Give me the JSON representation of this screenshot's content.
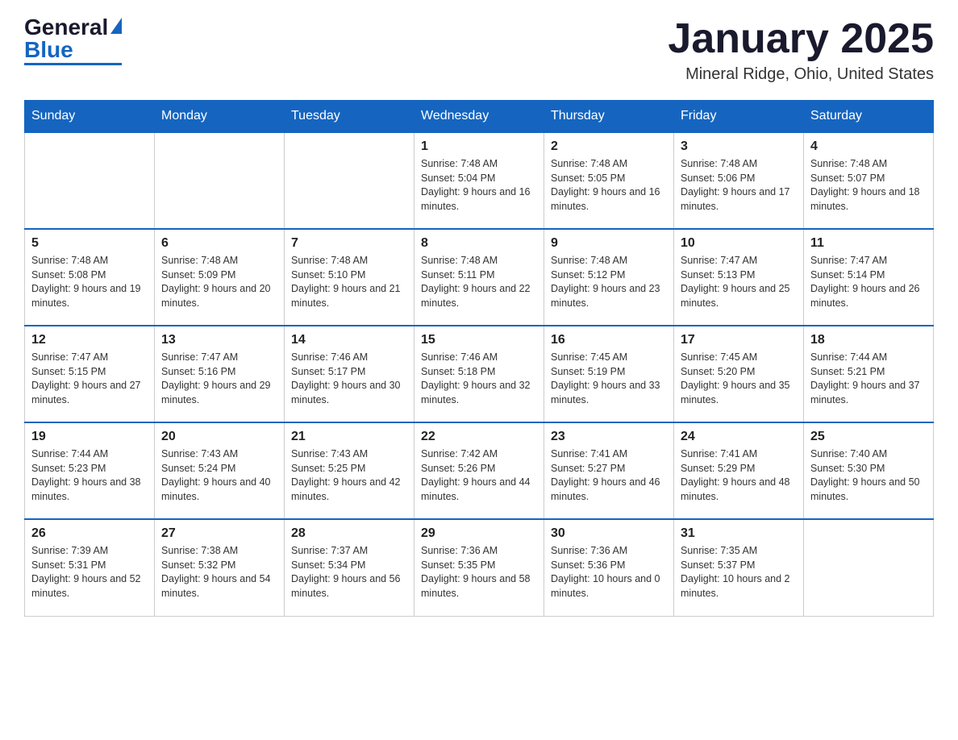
{
  "logo": {
    "general": "General",
    "blue": "Blue"
  },
  "header": {
    "title": "January 2025",
    "subtitle": "Mineral Ridge, Ohio, United States"
  },
  "weekdays": [
    "Sunday",
    "Monday",
    "Tuesday",
    "Wednesday",
    "Thursday",
    "Friday",
    "Saturday"
  ],
  "weeks": [
    [
      {
        "day": "",
        "info": ""
      },
      {
        "day": "",
        "info": ""
      },
      {
        "day": "",
        "info": ""
      },
      {
        "day": "1",
        "info": "Sunrise: 7:48 AM\nSunset: 5:04 PM\nDaylight: 9 hours and 16 minutes."
      },
      {
        "day": "2",
        "info": "Sunrise: 7:48 AM\nSunset: 5:05 PM\nDaylight: 9 hours and 16 minutes."
      },
      {
        "day": "3",
        "info": "Sunrise: 7:48 AM\nSunset: 5:06 PM\nDaylight: 9 hours and 17 minutes."
      },
      {
        "day": "4",
        "info": "Sunrise: 7:48 AM\nSunset: 5:07 PM\nDaylight: 9 hours and 18 minutes."
      }
    ],
    [
      {
        "day": "5",
        "info": "Sunrise: 7:48 AM\nSunset: 5:08 PM\nDaylight: 9 hours and 19 minutes."
      },
      {
        "day": "6",
        "info": "Sunrise: 7:48 AM\nSunset: 5:09 PM\nDaylight: 9 hours and 20 minutes."
      },
      {
        "day": "7",
        "info": "Sunrise: 7:48 AM\nSunset: 5:10 PM\nDaylight: 9 hours and 21 minutes."
      },
      {
        "day": "8",
        "info": "Sunrise: 7:48 AM\nSunset: 5:11 PM\nDaylight: 9 hours and 22 minutes."
      },
      {
        "day": "9",
        "info": "Sunrise: 7:48 AM\nSunset: 5:12 PM\nDaylight: 9 hours and 23 minutes."
      },
      {
        "day": "10",
        "info": "Sunrise: 7:47 AM\nSunset: 5:13 PM\nDaylight: 9 hours and 25 minutes."
      },
      {
        "day": "11",
        "info": "Sunrise: 7:47 AM\nSunset: 5:14 PM\nDaylight: 9 hours and 26 minutes."
      }
    ],
    [
      {
        "day": "12",
        "info": "Sunrise: 7:47 AM\nSunset: 5:15 PM\nDaylight: 9 hours and 27 minutes."
      },
      {
        "day": "13",
        "info": "Sunrise: 7:47 AM\nSunset: 5:16 PM\nDaylight: 9 hours and 29 minutes."
      },
      {
        "day": "14",
        "info": "Sunrise: 7:46 AM\nSunset: 5:17 PM\nDaylight: 9 hours and 30 minutes."
      },
      {
        "day": "15",
        "info": "Sunrise: 7:46 AM\nSunset: 5:18 PM\nDaylight: 9 hours and 32 minutes."
      },
      {
        "day": "16",
        "info": "Sunrise: 7:45 AM\nSunset: 5:19 PM\nDaylight: 9 hours and 33 minutes."
      },
      {
        "day": "17",
        "info": "Sunrise: 7:45 AM\nSunset: 5:20 PM\nDaylight: 9 hours and 35 minutes."
      },
      {
        "day": "18",
        "info": "Sunrise: 7:44 AM\nSunset: 5:21 PM\nDaylight: 9 hours and 37 minutes."
      }
    ],
    [
      {
        "day": "19",
        "info": "Sunrise: 7:44 AM\nSunset: 5:23 PM\nDaylight: 9 hours and 38 minutes."
      },
      {
        "day": "20",
        "info": "Sunrise: 7:43 AM\nSunset: 5:24 PM\nDaylight: 9 hours and 40 minutes."
      },
      {
        "day": "21",
        "info": "Sunrise: 7:43 AM\nSunset: 5:25 PM\nDaylight: 9 hours and 42 minutes."
      },
      {
        "day": "22",
        "info": "Sunrise: 7:42 AM\nSunset: 5:26 PM\nDaylight: 9 hours and 44 minutes."
      },
      {
        "day": "23",
        "info": "Sunrise: 7:41 AM\nSunset: 5:27 PM\nDaylight: 9 hours and 46 minutes."
      },
      {
        "day": "24",
        "info": "Sunrise: 7:41 AM\nSunset: 5:29 PM\nDaylight: 9 hours and 48 minutes."
      },
      {
        "day": "25",
        "info": "Sunrise: 7:40 AM\nSunset: 5:30 PM\nDaylight: 9 hours and 50 minutes."
      }
    ],
    [
      {
        "day": "26",
        "info": "Sunrise: 7:39 AM\nSunset: 5:31 PM\nDaylight: 9 hours and 52 minutes."
      },
      {
        "day": "27",
        "info": "Sunrise: 7:38 AM\nSunset: 5:32 PM\nDaylight: 9 hours and 54 minutes."
      },
      {
        "day": "28",
        "info": "Sunrise: 7:37 AM\nSunset: 5:34 PM\nDaylight: 9 hours and 56 minutes."
      },
      {
        "day": "29",
        "info": "Sunrise: 7:36 AM\nSunset: 5:35 PM\nDaylight: 9 hours and 58 minutes."
      },
      {
        "day": "30",
        "info": "Sunrise: 7:36 AM\nSunset: 5:36 PM\nDaylight: 10 hours and 0 minutes."
      },
      {
        "day": "31",
        "info": "Sunrise: 7:35 AM\nSunset: 5:37 PM\nDaylight: 10 hours and 2 minutes."
      },
      {
        "day": "",
        "info": ""
      }
    ]
  ]
}
